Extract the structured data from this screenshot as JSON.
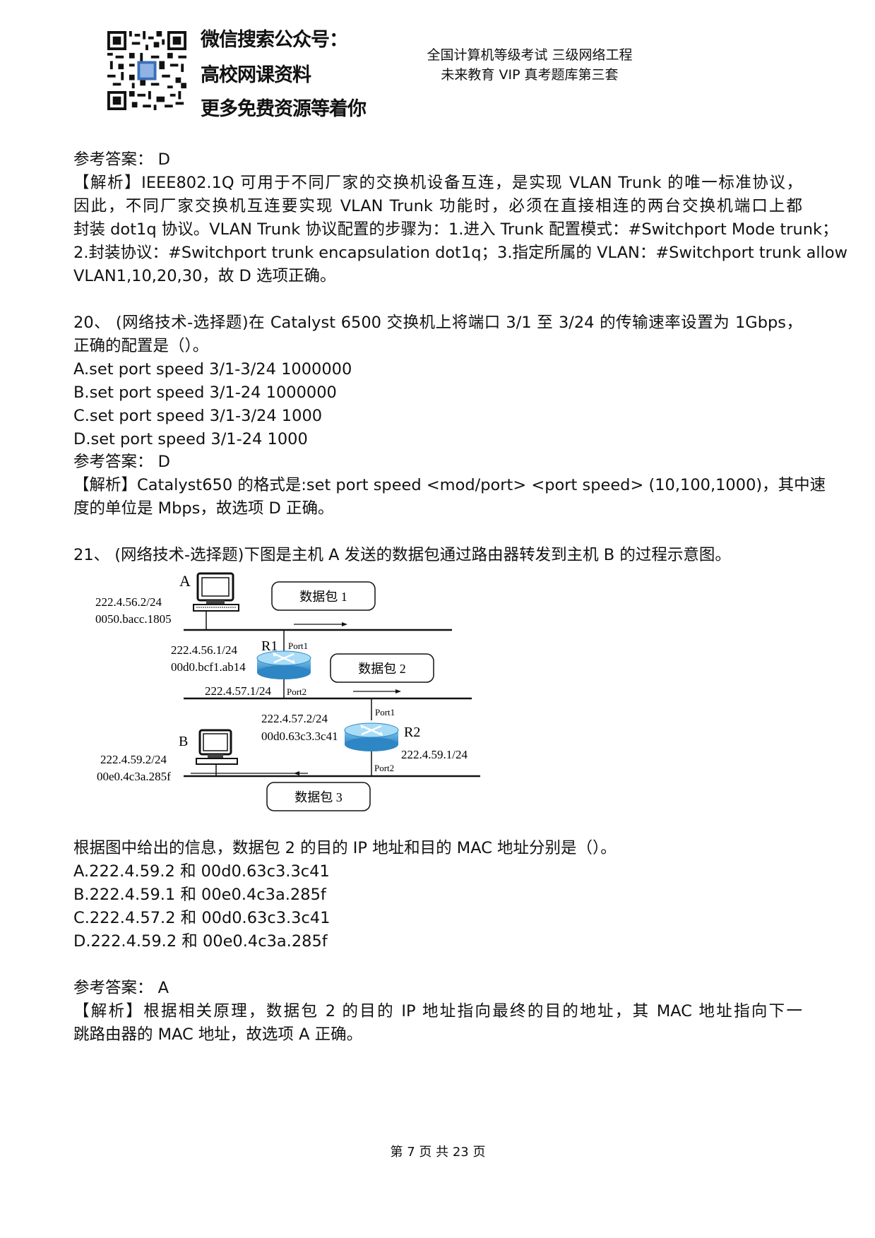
{
  "header": {
    "promo_lines": [
      "微信搜索公众号：",
      "高校网课资料",
      "更多免费资源等着你"
    ],
    "title_line1": "全国计算机等级考试 三级网络工程",
    "title_line2": "未来教育 VIP 真考题库第三套"
  },
  "q19_tail": {
    "answer": "参考答案： D",
    "analysis": [
      "【解析】IEEE802.1Q 可用于不同厂家的交换机设备互连，是实现 VLAN Trunk 的唯一标准协议，",
      "因此，不同厂家交换机互连要实现 VLAN Trunk 功能时，必须在直接相连的两台交换机端口上都",
      "封装 dot1q 协议。VLAN Trunk 协议配置的步骤为：1.进入 Trunk 配置模式：#Switchport Mode trunk；",
      "2.封装协议：#Switchport trunk encapsulation dot1q；3.指定所属的 VLAN：#Switchport trunk allow",
      "VLAN1,10,20,30，故 D 选项正确。"
    ]
  },
  "q20": {
    "stem": [
      "20、 (网络技术-选择题)在 Catalyst 6500 交换机上将端口 3/1 至 3/24 的传输速率设置为 1Gbps，",
      "正确的配置是（）。"
    ],
    "options": [
      "A.set port speed 3/1-3/24 1000000",
      "B.set port speed 3/1-24 1000000",
      "C.set port speed 3/1-3/24 1000",
      "D.set port speed 3/1-24 1000"
    ],
    "answer": "参考答案： D",
    "analysis": [
      "【解析】Catalyst650 的格式是:set port speed <mod/port> <port speed> (10,100,1000)，其中速",
      "度的单位是 Mbps，故选项 D 正确。"
    ]
  },
  "q21": {
    "stem": "21、 (网络技术-选择题)下图是主机 A 发送的数据包通过路由器转发到主机 B 的过程示意图。",
    "diagram": {
      "host_a": {
        "name": "A",
        "ip": "222.4.56.2/24",
        "mac": "0050.bacc.1805"
      },
      "host_b": {
        "name": "B",
        "ip": "222.4.59.2/24",
        "mac": "00e0.4c3a.285f"
      },
      "r1": {
        "name": "R1",
        "port1": "Port1",
        "port2": "Port2",
        "ip1": "222.4.56.1/24",
        "mac1": "00d0.bcf1.ab14",
        "ip2": "222.4.57.1/24"
      },
      "r2": {
        "name": "R2",
        "port1": "Port1",
        "port2": "Port2",
        "ip1": "222.4.57.2/24",
        "mac1": "00d0.63c3.3c41",
        "ip2": "222.4.59.1/24"
      },
      "packets": [
        "数据包 1",
        "数据包 2",
        "数据包 3"
      ]
    },
    "question": "根据图中给出的信息，数据包 2 的目的 IP 地址和目的 MAC 地址分别是（）。",
    "options": [
      "A.222.4.59.2 和 00d0.63c3.3c41",
      "B.222.4.59.1 和 00e0.4c3a.285f",
      "C.222.4.57.2 和 00d0.63c3.3c41",
      "D.222.4.59.2 和 00e0.4c3a.285f"
    ],
    "answer": "参考答案： A",
    "analysis": [
      "【解析】根据相关原理，数据包 2 的目的 IP 地址指向最终的目的地址，其 MAC 地址指向下一",
      "跳路由器的 MAC 地址，故选项 A 正确。"
    ]
  },
  "footer": "第 7 页 共 23 页"
}
